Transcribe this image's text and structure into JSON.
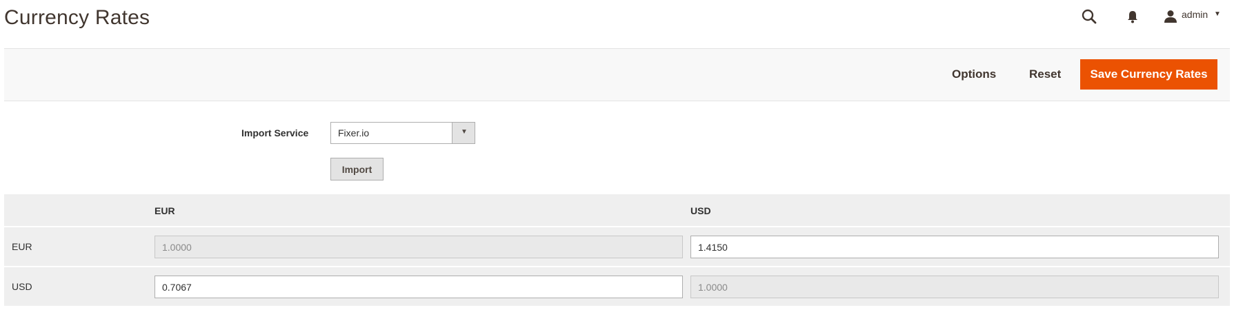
{
  "header": {
    "title": "Currency Rates",
    "user": "admin",
    "icons": [
      "search-icon",
      "bell-icon",
      "user-icon"
    ]
  },
  "actions": {
    "options_label": "Options",
    "reset_label": "Reset",
    "save_label": "Save Currency Rates"
  },
  "import": {
    "label": "Import Service",
    "selected_service": "Fixer.io",
    "button_label": "Import"
  },
  "grid": {
    "columns": [
      "EUR",
      "USD"
    ],
    "rows": [
      {
        "label": "EUR",
        "values": [
          "1.0000",
          "1.4150"
        ],
        "disabled": [
          true,
          false
        ]
      },
      {
        "label": "USD",
        "values": [
          "0.7067",
          "1.0000"
        ],
        "disabled": [
          false,
          true
        ]
      }
    ]
  },
  "colors": {
    "accent": "#eb5202",
    "text_dark": "#41362f",
    "grid_bg": "#efefef"
  }
}
